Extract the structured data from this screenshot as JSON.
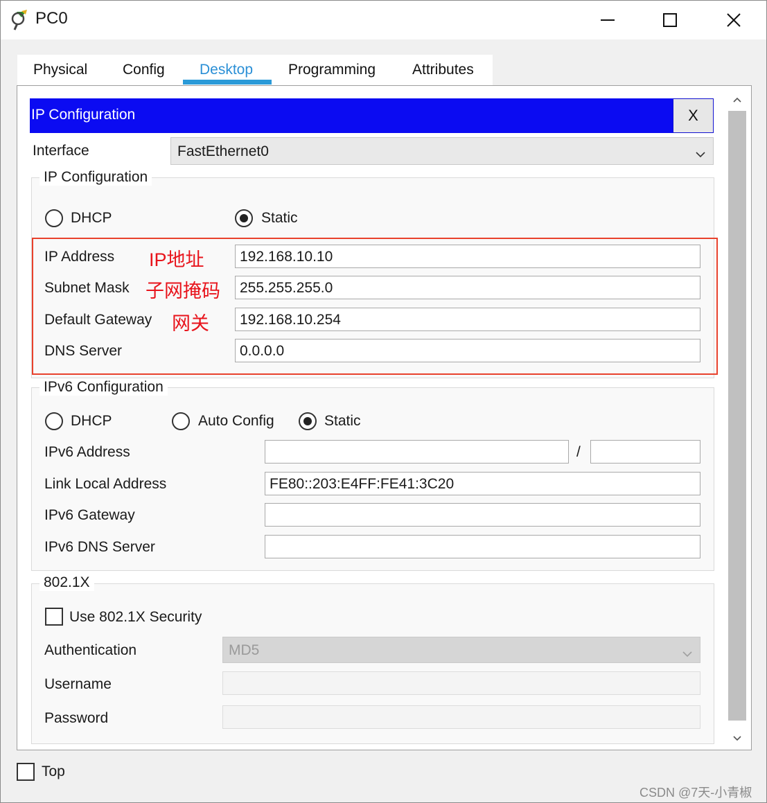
{
  "window": {
    "title": "PC0"
  },
  "tabs": [
    "Physical",
    "Config",
    "Desktop",
    "Programming",
    "Attributes"
  ],
  "active_tab": "Desktop",
  "ip_config": {
    "header": "IP Configuration",
    "close_label": "X",
    "interface_label": "Interface",
    "interface_value": "FastEthernet0",
    "ipv4_group_title": "IP Configuration",
    "dhcp_label": "DHCP",
    "static_label": "Static",
    "mode_selected": "Static",
    "ip_address_label": "IP Address",
    "ip_address_value": "192.168.10.10",
    "subnet_mask_label": "Subnet Mask",
    "subnet_mask_value": "255.255.255.0",
    "default_gateway_label": "Default Gateway",
    "default_gateway_value": "192.168.10.254",
    "dns_server_label": "DNS Server",
    "dns_server_value": "0.0.0.0"
  },
  "annotations": {
    "ip_address": "IP地址",
    "subnet_mask": "子网掩码",
    "gateway": "网关"
  },
  "ipv6_config": {
    "group_title": "IPv6 Configuration",
    "dhcp_label": "DHCP",
    "auto_config_label": "Auto Config",
    "static_label": "Static",
    "mode_selected": "Static",
    "address_label": "IPv6 Address",
    "address_value": "",
    "prefix_separator": "/",
    "prefix_value": "",
    "link_local_label": "Link Local Address",
    "link_local_value": "FE80::203:E4FF:FE41:3C20",
    "gateway_label": "IPv6 Gateway",
    "gateway_value": "",
    "dns_label": "IPv6 DNS Server",
    "dns_value": ""
  },
  "dot1x": {
    "group_title": "802.1X",
    "use_security_label": "Use 802.1X Security",
    "use_security_checked": false,
    "authentication_label": "Authentication",
    "authentication_value": "MD5",
    "username_label": "Username",
    "password_label": "Password"
  },
  "footer": {
    "top_label": "Top",
    "top_checked": false,
    "watermark": "CSDN @7天-小青椒"
  },
  "colors": {
    "header_bg": "#0b0bf2",
    "active_tab": "#2a8fd6",
    "annotation": "#e8141c",
    "highlight_box": "#e8412c"
  }
}
